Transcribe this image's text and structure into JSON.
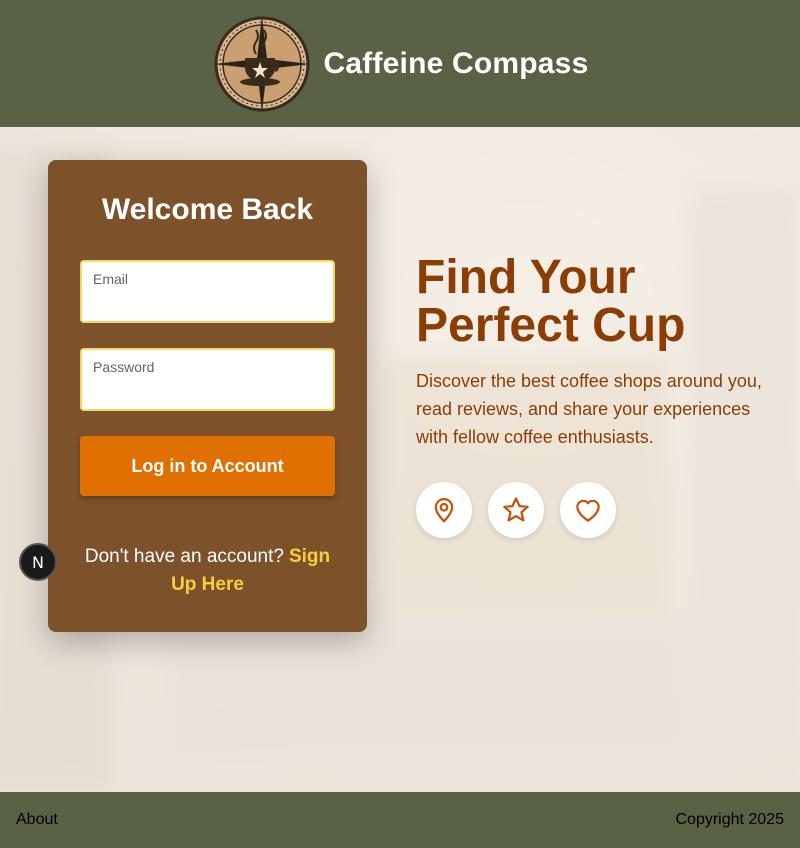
{
  "header": {
    "brand": "Caffeine Compass",
    "logo_icon": "compass-coffee-cup-logo"
  },
  "login": {
    "title": "Welcome Back",
    "email_label": "Email",
    "email_value": "",
    "password_label": "Password",
    "password_value": "",
    "submit_label": "Log in to Account",
    "signup_prompt": "Don't have an account?",
    "signup_link": "Sign Up Here"
  },
  "hero": {
    "title_line1": "Find Your",
    "title_line2": "Perfect Cup",
    "description": "Discover the best coffee shops around you, read reviews, and share your experiences with fellow coffee enthusiasts.",
    "icons": [
      "map-pin-icon",
      "star-icon",
      "heart-icon"
    ]
  },
  "dev_badge": {
    "letter": "N"
  },
  "footer": {
    "about": "About",
    "copyright": "Copyright 2025"
  },
  "colors": {
    "header_bg": "#5a6246",
    "card_bg": "#7d522b",
    "button_bg": "#e07000",
    "accent_text": "#8a3d05",
    "link": "#f7cf3d"
  }
}
